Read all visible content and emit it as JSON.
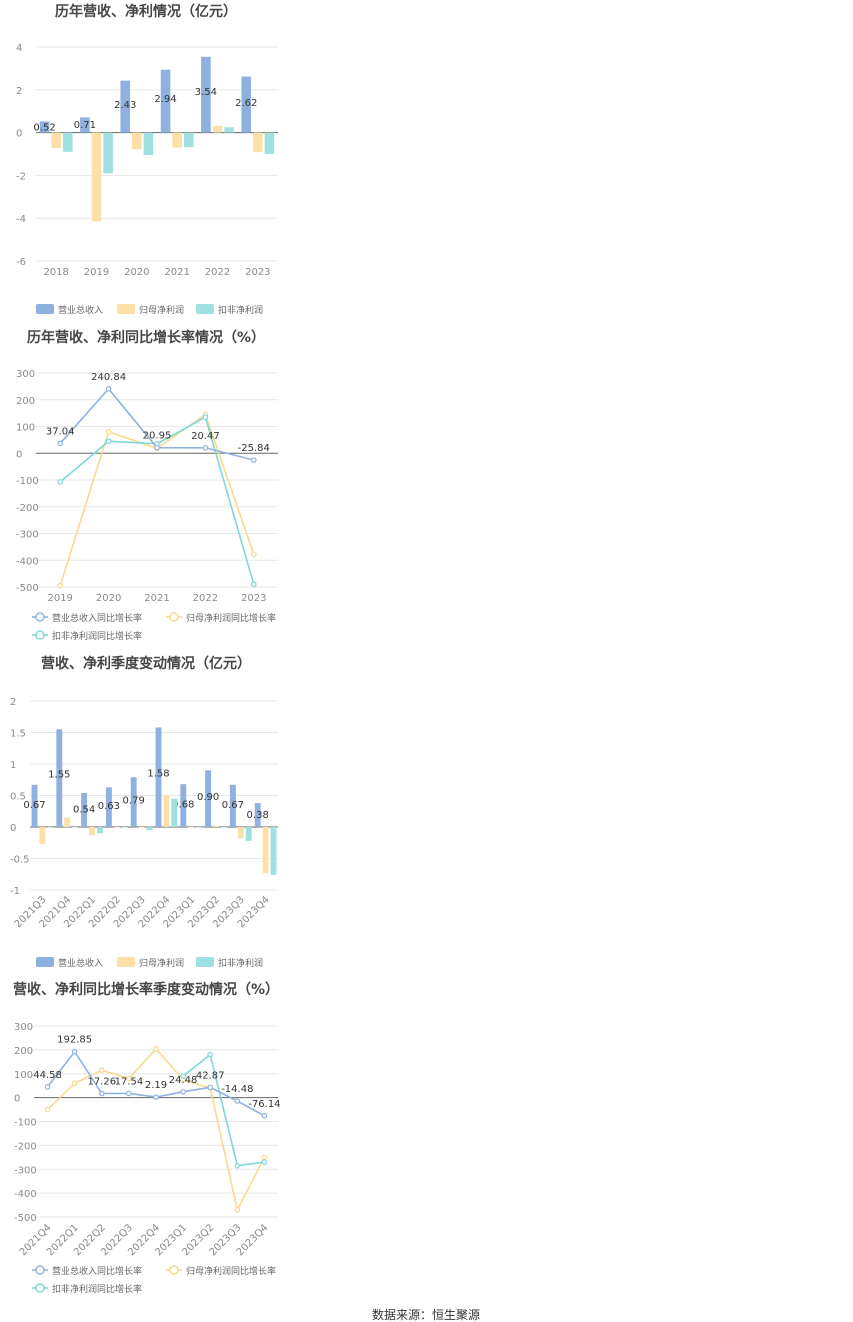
{
  "colors": {
    "revenue": "#8fb1df",
    "net_profit": "#fde0a8",
    "deducted_profit": "#9fe0e0",
    "revenue_line": "#8fb1df",
    "net_profit_line": "#f9d98e",
    "deducted_profit_line": "#7dd7dc",
    "grid": "#e8e8e8",
    "axis": "#666666"
  },
  "source": "数据来源：恒生聚源",
  "chart_data": [
    {
      "type": "bar",
      "title": "历年营收、净利情况（亿元）",
      "categories": [
        "2018",
        "2019",
        "2020",
        "2021",
        "2022",
        "2023"
      ],
      "ylim": [
        -6,
        4
      ],
      "yticks": [
        4,
        2,
        0,
        -2,
        -4,
        -6
      ],
      "series": [
        {
          "name": "营业总收入",
          "values": [
            0.52,
            0.71,
            2.43,
            2.94,
            3.54,
            2.62
          ],
          "labels": [
            "0.52",
            "0.71",
            "2.43",
            "2.94",
            "3.54",
            "2.62"
          ]
        },
        {
          "name": "归母净利润",
          "values": [
            -0.72,
            -4.15,
            -0.78,
            -0.7,
            0.32,
            -0.9
          ]
        },
        {
          "name": "扣非净利润",
          "values": [
            -0.9,
            -1.9,
            -1.05,
            -0.68,
            0.25,
            -1.0
          ]
        }
      ],
      "legend": "bottom-left",
      "grid": true
    },
    {
      "type": "line",
      "title": "历年营收、净利同比增长率情况（%）",
      "categories": [
        "2019",
        "2020",
        "2021",
        "2022",
        "2023"
      ],
      "ylim": [
        -500,
        300
      ],
      "yticks": [
        300,
        200,
        100,
        0,
        -100,
        -200,
        -300,
        -400,
        -500
      ],
      "series": [
        {
          "name": "营业总收入同比增长率",
          "values": [
            37.04,
            240.84,
            20.95,
            20.47,
            -25.84
          ],
          "labels": [
            "37.04",
            "240.84",
            "20.95",
            "20.47",
            "-25.84"
          ]
        },
        {
          "name": "归母净利润同比增长率",
          "values": [
            -495,
            80,
            18,
            145,
            -378
          ]
        },
        {
          "name": "扣非净利润同比增长率",
          "values": [
            -107,
            45,
            35,
            135,
            -490
          ]
        }
      ],
      "legend": "bottom-left",
      "grid": true
    },
    {
      "type": "bar",
      "title": "营收、净利季度变动情况（亿元）",
      "categories": [
        "2021Q3",
        "2021Q4",
        "2022Q1",
        "2022Q2",
        "2022Q3",
        "2022Q4",
        "2023Q1",
        "2023Q2",
        "2023Q3",
        "2023Q4"
      ],
      "ylim": [
        -1,
        2
      ],
      "yticks": [
        2,
        1.5,
        1,
        0.5,
        0,
        -0.5,
        -1
      ],
      "series": [
        {
          "name": "营业总收入",
          "values": [
            0.67,
            1.55,
            0.54,
            0.63,
            0.79,
            1.58,
            0.68,
            0.9,
            0.67,
            0.38
          ],
          "labels": [
            "0.67",
            "1.55",
            "0.54",
            "0.63",
            "0.79",
            "1.58",
            "0.68",
            "0.90",
            "0.67",
            "0.38"
          ]
        },
        {
          "name": "归母净利润",
          "values": [
            -0.27,
            0.15,
            -0.13,
            0.0,
            0.0,
            0.5,
            0.0,
            0.02,
            -0.18,
            -0.73
          ]
        },
        {
          "name": "扣非净利润",
          "values": [
            0.0,
            0.0,
            -0.1,
            0.0,
            -0.05,
            0.45,
            0.0,
            0.0,
            -0.22,
            -0.76
          ]
        }
      ],
      "legend": "bottom-left",
      "grid": true
    },
    {
      "type": "line",
      "title": "营收、净利同比增长率季度变动情况（%）",
      "categories": [
        "2021Q4",
        "2022Q1",
        "2022Q2",
        "2022Q3",
        "2022Q4",
        "2023Q1",
        "2023Q2",
        "2023Q3",
        "2023Q4"
      ],
      "ylim": [
        -500,
        300
      ],
      "yticks": [
        300,
        200,
        100,
        0,
        -100,
        -200,
        -300,
        -400,
        -500
      ],
      "series": [
        {
          "name": "营业总收入同比增长率",
          "values": [
            44.58,
            192.85,
            17.26,
            17.54,
            2.19,
            24.48,
            42.87,
            -14.48,
            -76.14
          ],
          "labels": [
            "44.58",
            "192.85",
            "17.26",
            "17.54",
            "2.19",
            "24.48",
            "42.87",
            "-14.48",
            "-76.14"
          ]
        },
        {
          "name": "归母净利润同比增长率",
          "values": [
            -50,
            60,
            115,
            80,
            205,
            75,
            40,
            -470,
            -250
          ]
        },
        {
          "name": "扣非净利润同比增长率",
          "values": [
            null,
            null,
            null,
            null,
            null,
            90,
            180,
            -285,
            -270
          ]
        }
      ],
      "legend": "bottom-left",
      "grid": true
    }
  ]
}
